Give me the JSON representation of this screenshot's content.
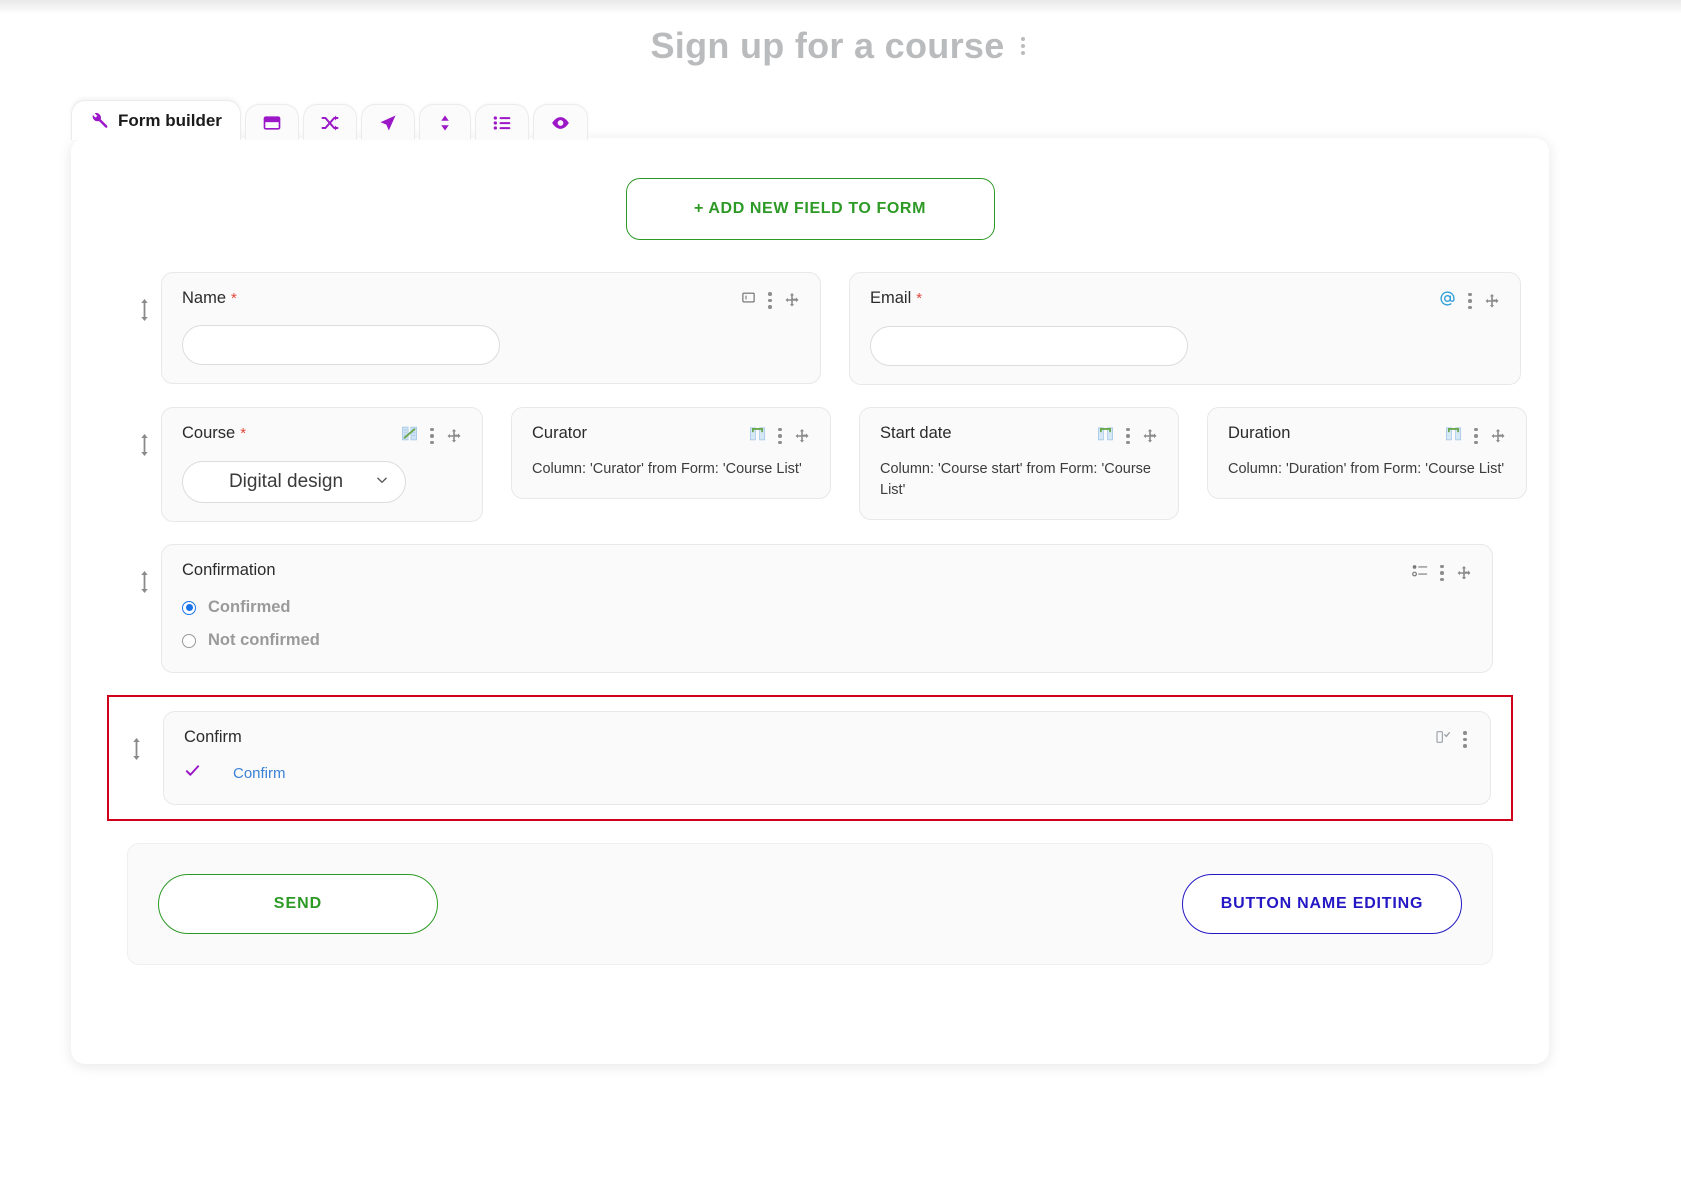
{
  "header": {
    "title": "Sign up for a course",
    "menu_icon": "vertical-dots-icon"
  },
  "tabs": [
    {
      "label": "Form builder",
      "icon": "wrench-icon",
      "active": true
    },
    {
      "label": "",
      "icon": "window-icon",
      "active": false
    },
    {
      "label": "",
      "icon": "shuffle-icon",
      "active": false
    },
    {
      "label": "",
      "icon": "paper-plane-icon",
      "active": false
    },
    {
      "label": "",
      "icon": "sort-updown-icon",
      "active": false
    },
    {
      "label": "",
      "icon": "list-icon",
      "active": false
    },
    {
      "label": "",
      "icon": "eye-icon",
      "active": false
    }
  ],
  "toolbar": {
    "add_field_label": "+ ADD NEW FIELD TO FORM"
  },
  "fields": {
    "name": {
      "label": "Name",
      "required_marker": "*",
      "value": "",
      "icon": "text-field-icon"
    },
    "email": {
      "label": "Email",
      "required_marker": "*",
      "value": "",
      "icon": "at-sign-icon"
    },
    "course": {
      "label": "Course",
      "required_marker": "*",
      "selected": "Digital design",
      "icon": "spreadsheet-link-icon"
    },
    "curator": {
      "label": "Curator",
      "description": "Column: 'Curator' from Form: 'Course List'",
      "icon": "table-column-icon"
    },
    "start_date": {
      "label": "Start date",
      "description": "Column: 'Course start' from Form: 'Course List'",
      "icon": "table-column-icon"
    },
    "duration": {
      "label": "Duration",
      "description": "Column: 'Duration' from Form: 'Course List'",
      "icon": "table-column-icon"
    },
    "confirmation": {
      "label": "Confirmation",
      "icon": "radio-list-icon",
      "options": [
        {
          "label": "Confirmed",
          "selected": true
        },
        {
          "label": "Not confirmed",
          "selected": false
        }
      ]
    },
    "confirm": {
      "label": "Confirm",
      "checkbox_label": "Confirm",
      "checked": true,
      "icon": "checkbox-field-icon"
    }
  },
  "footer": {
    "send_label": "SEND",
    "edit_label": "BUTTON NAME EDITING"
  },
  "colors": {
    "green": "#2d9a26",
    "blue": "#2418c4",
    "purple": "#9b17c8",
    "red_highlight": "#d0021b",
    "link_blue": "#3b82d6",
    "required_red": "#e2483d"
  }
}
